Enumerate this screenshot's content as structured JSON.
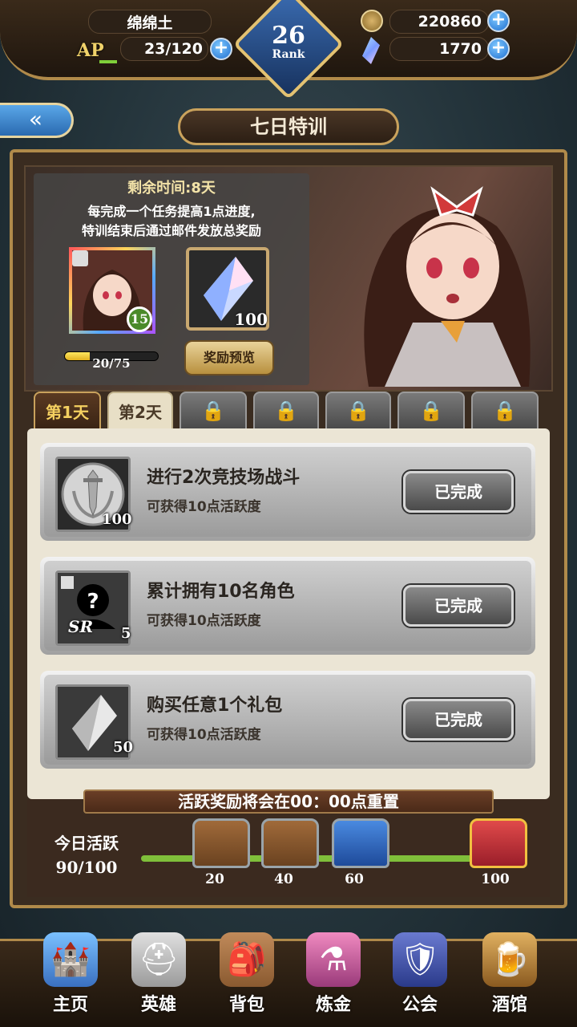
{
  "header": {
    "player_name": "绵绵土",
    "ap_label": "AP",
    "ap_value": "23/120",
    "rank": "26",
    "rank_label": "Rank",
    "gold": "220860",
    "crystals": "1770"
  },
  "page": {
    "title": "七日特训"
  },
  "banner": {
    "remaining": "剩余时间:8天",
    "desc_line1": "每完成一个任务提高1点进度,",
    "desc_line2": "特训结束后通过邮件发放总奖励",
    "card_count": "15",
    "crystal_count": "100",
    "progress": "20/75",
    "preview_label": "奖励预览"
  },
  "tabs": [
    "第1天",
    "第2天"
  ],
  "tasks": [
    {
      "title": "进行2次竞技场战斗",
      "subtitle": "可获得10点活跃度",
      "count": "100",
      "status": "已完成"
    },
    {
      "title": "累计拥有10名角色",
      "subtitle": "可获得10点活跃度",
      "count": "5",
      "rarity": "SR",
      "status": "已完成"
    },
    {
      "title": "购买任意1个礼包",
      "subtitle": "可获得10点活跃度",
      "count": "50",
      "status": "已完成"
    }
  ],
  "activity": {
    "reset_notice": "活跃奖励将会在00：00点重置",
    "label": "今日活跃",
    "value": "90/100",
    "milestones": [
      "20",
      "40",
      "60",
      "100"
    ]
  },
  "nav": [
    "主页",
    "英雄",
    "背包",
    "炼金",
    "公会",
    "酒馆"
  ]
}
